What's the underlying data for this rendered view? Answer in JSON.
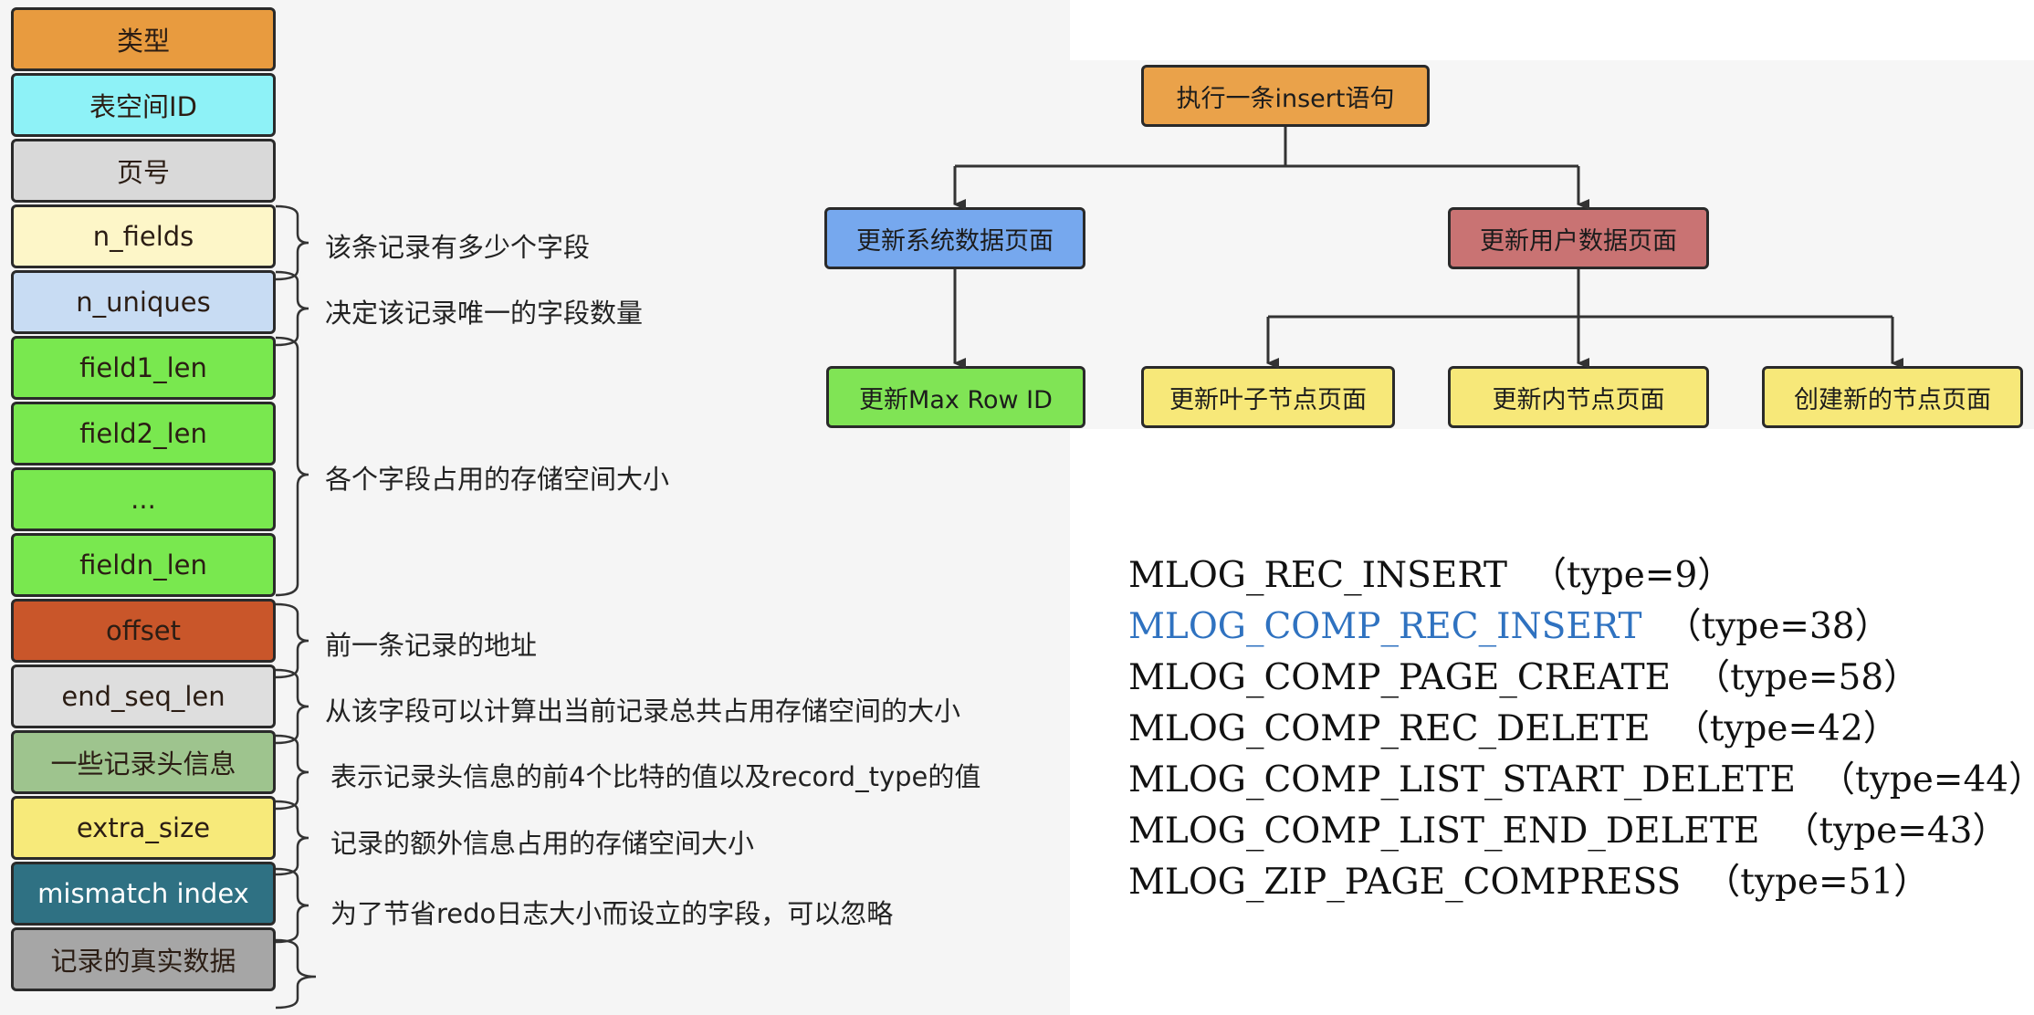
{
  "record_fields": [
    {
      "label": "类型",
      "color": "#e89b3f",
      "text_tone": "dark"
    },
    {
      "label": "表空间ID",
      "color": "#8ef2f7",
      "text_tone": "dark"
    },
    {
      "label": "页号",
      "color": "#d9d9d9",
      "text_tone": "dark"
    },
    {
      "label": "n_fields",
      "color": "#fdf6c8",
      "text_tone": "dark"
    },
    {
      "label": "n_uniques",
      "color": "#c8dcf3",
      "text_tone": "dark"
    },
    {
      "label": "field1_len",
      "color": "#79e84f",
      "text_tone": "dark"
    },
    {
      "label": "field2_len",
      "color": "#79e84f",
      "text_tone": "dark"
    },
    {
      "label": "...",
      "color": "#79e84f",
      "text_tone": "dark"
    },
    {
      "label": "fieldn_len",
      "color": "#79e84f",
      "text_tone": "dark"
    },
    {
      "label": "offset",
      "color": "#c9562a",
      "text_tone": "dark"
    },
    {
      "label": "end_seq_len",
      "color": "#dedede",
      "text_tone": "dark"
    },
    {
      "label": "一些记录头信息",
      "color": "#9ec48e",
      "text_tone": "dark"
    },
    {
      "label": "extra_size",
      "color": "#f7ea7a",
      "text_tone": "dark"
    },
    {
      "label": "mismatch index",
      "color": "#2f7183",
      "text_tone": "light"
    },
    {
      "label": "记录的真实数据",
      "color": "#a6a6a6",
      "text_tone": "dark"
    }
  ],
  "field_notes": [
    {
      "text": "该条记录有多少个字段"
    },
    {
      "text": "决定该记录唯一的字段数量"
    },
    {
      "text": "各个字段占用的存储空间大小"
    },
    {
      "text": "前一条记录的地址"
    },
    {
      "text": "从该字段可以计算出当前记录总共占用存储空间的大小"
    },
    {
      "text": "表示记录头信息的前4个比特的值以及record_type的值"
    },
    {
      "text": "记录的额外信息占用的存储空间大小"
    },
    {
      "text": "为了节省redo日志大小而设立的字段，可以忽略"
    },
    {
      "text": ""
    }
  ],
  "flowchart": {
    "root": {
      "label": "执行一条insert语句",
      "color": "#eaa24a"
    },
    "system_update": {
      "label": "更新系统数据页面",
      "color": "#76a8ee"
    },
    "user_update": {
      "label": "更新用户数据页面",
      "color": "#c97373"
    },
    "max_row_id": {
      "label": "更新Max Row ID",
      "color": "#80e455"
    },
    "leaf_page": {
      "label": "更新叶子节点页面",
      "color": "#f7e879"
    },
    "inner_page": {
      "label": "更新内节点页面",
      "color": "#f7e879"
    },
    "new_page": {
      "label": "创建新的节点页面",
      "color": "#f7e879"
    }
  },
  "mlog_types": [
    {
      "name": "MLOG_REC_INSERT",
      "type": "（type=9）",
      "highlighted": false
    },
    {
      "name": "MLOG_COMP_REC_INSERT",
      "type": "（type=38）",
      "highlighted": true
    },
    {
      "name": "MLOG_COMP_PAGE_CREATE",
      "type": "（type=58）",
      "highlighted": false
    },
    {
      "name": "MLOG_COMP_REC_DELETE",
      "type": "（type=42）",
      "highlighted": false
    },
    {
      "name": "MLOG_COMP_LIST_START_DELETE",
      "type": "（type=44）",
      "highlighted": false
    },
    {
      "name": "MLOG_COMP_LIST_END_DELETE",
      "type": "（type=43）",
      "highlighted": false
    },
    {
      "name": "MLOG_ZIP_PAGE_COMPRESS",
      "type": "（type=51）",
      "highlighted": false
    }
  ],
  "colors": {
    "highlight": "#2f72c0",
    "text": "#111111",
    "border": "#2a2a2a"
  }
}
